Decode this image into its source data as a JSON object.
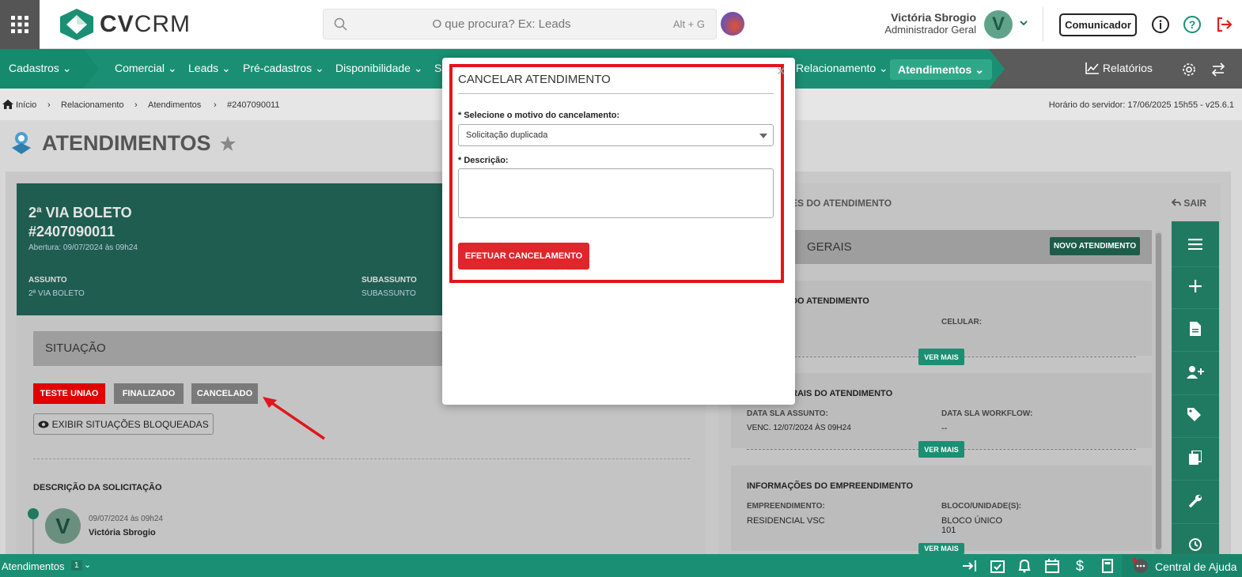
{
  "topbar": {
    "logo_bold": "CV",
    "logo_light": "CRM",
    "search_placeholder": "O que procura? Ex: Leads",
    "search_shortcut": "Alt + G",
    "user_name": "Victória Sbrogio",
    "user_role": "Administrador Geral",
    "avatar_letter": "V",
    "comunicador_label": "Comunicador"
  },
  "nav": {
    "items": [
      "Cadastros",
      "Comercial",
      "Leads",
      "Pré-cadastros",
      "Disponibilidade",
      "S",
      "Relacionamento",
      "Atendimentos",
      "Relatórios"
    ]
  },
  "breadcrumb": {
    "items": [
      "Início",
      "Relacionamento",
      "Atendimentos",
      "#2407090011"
    ],
    "server_time": "Horário do servidor: 17/06/2025 15h55 - v25.6.1"
  },
  "page": {
    "title": "ATENDIMENTOS"
  },
  "hero": {
    "title": "2ª VIA BOLETO",
    "code": "#2407090011",
    "abertura": "Abertura: 09/07/2024 às 09h24",
    "assunto_label": "ASSUNTO",
    "assunto_value": "2ª VIA BOLETO",
    "subassunto_label": "SUBASSUNTO",
    "subassunto_value": "SUBASSUNTO"
  },
  "situacao": {
    "title": "SITUAÇÃO",
    "buttons": [
      "TESTE UNIAO",
      "FINALIZADO",
      "CANCELADO"
    ],
    "exibir_label": "EXIBIR SITUAÇÕES BLOQUEADAS",
    "colors": {
      "red": "#e00000",
      "gray": "#7a7a7a"
    }
  },
  "descricao": {
    "title": "DESCRIÇÃO DA SOLICITAÇÃO",
    "avatar_letter": "V",
    "date": "09/07/2024 às 09h24",
    "name": "Victória Sbrogio"
  },
  "right": {
    "title": "ES DO ATENDIMENTO",
    "sair": "SAIR",
    "geral_title": "GERAIS",
    "novo_btn": "NOVO ATENDIMENTO",
    "p1_title": "DO ATENDIMENTO",
    "p1_celular": "CELULAR:",
    "ver_mais": "VER MAIS",
    "p2_title": "RAIS DO ATENDIMENTO",
    "p2_l1": "DATA SLA ASSUNTO:",
    "p2_v1": "VENC. 12/07/2024 ÀS 09H24",
    "p2_l2": "DATA SLA WORKFLOW:",
    "p2_v2": "--",
    "p3_title": "INFORMAÇÕES DO EMPREENDIMENTO",
    "p3_l1": "EMPREENDIMENTO:",
    "p3_v1": "RESIDENCIAL VSC",
    "p3_l2": "BLOCO/UNIDADE(S):",
    "p3_v2a": "BLOCO ÚNICO",
    "p3_v2b": "101"
  },
  "bottom": {
    "label": "Atendimentos",
    "count": "1",
    "ajuda": "Central de Ajuda"
  },
  "modal": {
    "title": "CANCELAR ATENDIMENTO",
    "close": "×",
    "motivo_label": "* Selecione o motivo do cancelamento:",
    "motivo_value": "Solicitação duplicada",
    "descricao_label": "* Descrição:",
    "descricao_value": "",
    "submit": "EFETUAR CANCELAMENTO"
  }
}
